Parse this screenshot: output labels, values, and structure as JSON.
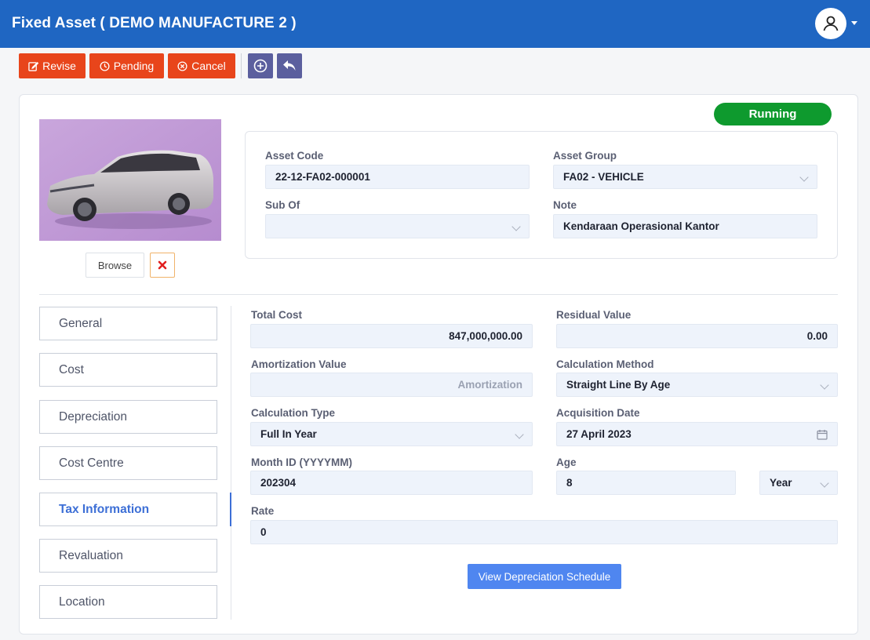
{
  "header": {
    "title": "Fixed Asset ( DEMO MANUFACTURE 2 )"
  },
  "toolbar": {
    "revise": "Revise",
    "pending": "Pending",
    "cancel": "Cancel"
  },
  "status": "Running",
  "photo": {
    "browse_label": "Browse"
  },
  "head_fields": {
    "asset_code_label": "Asset Code",
    "asset_code": "22-12-FA02-000001",
    "asset_group_label": "Asset Group",
    "asset_group": "FA02 - VEHICLE",
    "sub_of_label": "Sub Of",
    "sub_of": "",
    "note_label": "Note",
    "note": "Kendaraan Operasional Kantor"
  },
  "tabs": [
    "General",
    "Cost",
    "Depreciation",
    "Cost Centre",
    "Tax Information",
    "Revaluation",
    "Location"
  ],
  "active_tab": "Tax Information",
  "tax": {
    "total_cost_label": "Total Cost",
    "total_cost": "847,000,000.00",
    "residual_label": "Residual Value",
    "residual": "0.00",
    "amort_label": "Amortization Value",
    "amort_placeholder": "Amortization",
    "calc_method_label": "Calculation Method",
    "calc_method": "Straight Line By Age",
    "calc_type_label": "Calculation Type",
    "calc_type": "Full In Year",
    "acq_date_label": "Acquisition Date",
    "acq_date": "27 April 2023",
    "month_id_label": "Month ID (YYYYMM)",
    "month_id": "202304",
    "age_label": "Age",
    "age": "8",
    "age_unit": "Year",
    "rate_label": "Rate",
    "rate": "0"
  },
  "view_schedule": "View Depreciation Schedule",
  "colors": {
    "header": "#1f66c2",
    "action": "#e8451b",
    "icon_btn": "#5b5f9e",
    "status": "#0e9a2e",
    "accent": "#3d6fd6",
    "primary": "#4f86f0"
  }
}
